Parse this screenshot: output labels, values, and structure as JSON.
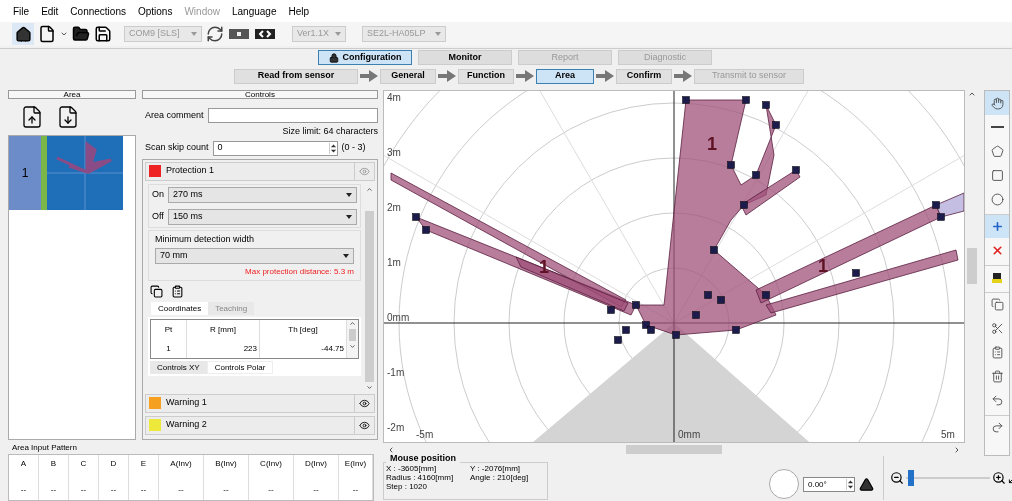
{
  "menu": [
    {
      "label": "File",
      "disabled": false
    },
    {
      "label": "Edit",
      "disabled": false
    },
    {
      "label": "Connections",
      "disabled": false
    },
    {
      "label": "Options",
      "disabled": false
    },
    {
      "label": "Window",
      "disabled": true
    },
    {
      "label": "Language",
      "disabled": false
    },
    {
      "label": "Help",
      "disabled": false
    }
  ],
  "toolbar": {
    "port": "COM9 [SLS]",
    "version": "Ver1.1X",
    "model": "SE2L-HA05LP"
  },
  "mode_tabs": [
    {
      "label": "Configuration",
      "selected": true,
      "disabled": false
    },
    {
      "label": "Monitor",
      "selected": false,
      "disabled": false
    },
    {
      "label": "Report",
      "selected": false,
      "disabled": true
    },
    {
      "label": "Diagnostic",
      "selected": false,
      "disabled": true
    }
  ],
  "steps": [
    {
      "label": "Read from sensor",
      "selected": false,
      "disabled": false
    },
    {
      "label": "General",
      "selected": false,
      "disabled": false
    },
    {
      "label": "Function",
      "selected": false,
      "disabled": false
    },
    {
      "label": "Area",
      "selected": true,
      "disabled": false
    },
    {
      "label": "Confirm",
      "selected": false,
      "disabled": false
    },
    {
      "label": "Transmit to sensor",
      "selected": false,
      "disabled": true
    }
  ],
  "area_panel": {
    "title": "Area",
    "areas": [
      {
        "label": "1",
        "selected": true
      }
    ]
  },
  "controls": {
    "title": "Controls",
    "comment_label": "Area comment",
    "size_limit": "Size limit: 64 characters",
    "scan_skip_label": "Scan skip count",
    "scan_skip_value": "0",
    "scan_skip_range": "(0 - 3)",
    "zones": [
      {
        "name": "Protection 1",
        "color": "#ee2222",
        "expanded": true
      },
      {
        "name": "Warning 1",
        "color": "#f5a020",
        "expanded": false
      },
      {
        "name": "Warning 2",
        "color": "#eee83a",
        "expanded": false
      }
    ],
    "on_label": "On",
    "on_value": "270 ms",
    "off_label": "Off",
    "off_value": "150 ms",
    "min_width_label": "Minimum detection width",
    "min_width_value": "70 mm",
    "max_distance": "Max protection distance: 5.3 m",
    "coord_tabs": [
      {
        "label": "Coordinates",
        "selected": true
      },
      {
        "label": "Teaching",
        "selected": false
      }
    ],
    "table": {
      "columns": [
        "Pt",
        "R [mm]",
        "Th [deg]"
      ],
      "rows": [
        [
          "1",
          "223",
          "-44.75"
        ]
      ]
    },
    "view_tabs": [
      {
        "label": "Controls XY",
        "selected": false
      },
      {
        "label": "Controls Polar",
        "selected": true
      }
    ]
  },
  "canvas": {
    "y_labels": [
      "4m",
      "3m",
      "2m",
      "1m",
      "0mm",
      "-1m",
      "-2m"
    ],
    "x_labels": [
      "-5m",
      "0mm",
      "5m"
    ],
    "zone_labels": [
      "1",
      "1",
      "1"
    ]
  },
  "input_pattern": {
    "title": "Area Input Pattern",
    "columns": [
      "A",
      "B",
      "C",
      "D",
      "E",
      "A(Inv)",
      "B(Inv)",
      "C(Inv)",
      "D(Inv)",
      "E(Inv)"
    ],
    "values": [
      "--",
      "--",
      "--",
      "--",
      "--",
      "--",
      "--",
      "--",
      "--",
      "--"
    ]
  },
  "mouse_position": {
    "title": "Mouse position",
    "x": "X : -3605[mm]",
    "y": "Y : -2076[mm]",
    "radius": "Radius : 4160[mm]",
    "angle": "Angle : 210[deg]",
    "step": "Step : 1020"
  },
  "rotation": {
    "value": "0.00°"
  },
  "zoom": {
    "level": 0.03
  },
  "tools": [
    {
      "kind": "hand",
      "selected": true
    },
    {
      "kind": "line",
      "selected": false
    },
    {
      "kind": "polygon",
      "selected": false
    },
    {
      "kind": "rectangle",
      "selected": false
    },
    {
      "kind": "circle",
      "selected": false
    },
    {
      "kind": "add",
      "selected": true
    },
    {
      "kind": "delete",
      "selected": false
    },
    {
      "kind": "sensor",
      "selected": false
    },
    {
      "kind": "copy",
      "selected": false
    },
    {
      "kind": "cut",
      "selected": false
    },
    {
      "kind": "paste",
      "selected": false
    },
    {
      "kind": "trash",
      "selected": false
    },
    {
      "kind": "undo",
      "selected": false
    },
    {
      "kind": "redo",
      "selected": false
    }
  ]
}
